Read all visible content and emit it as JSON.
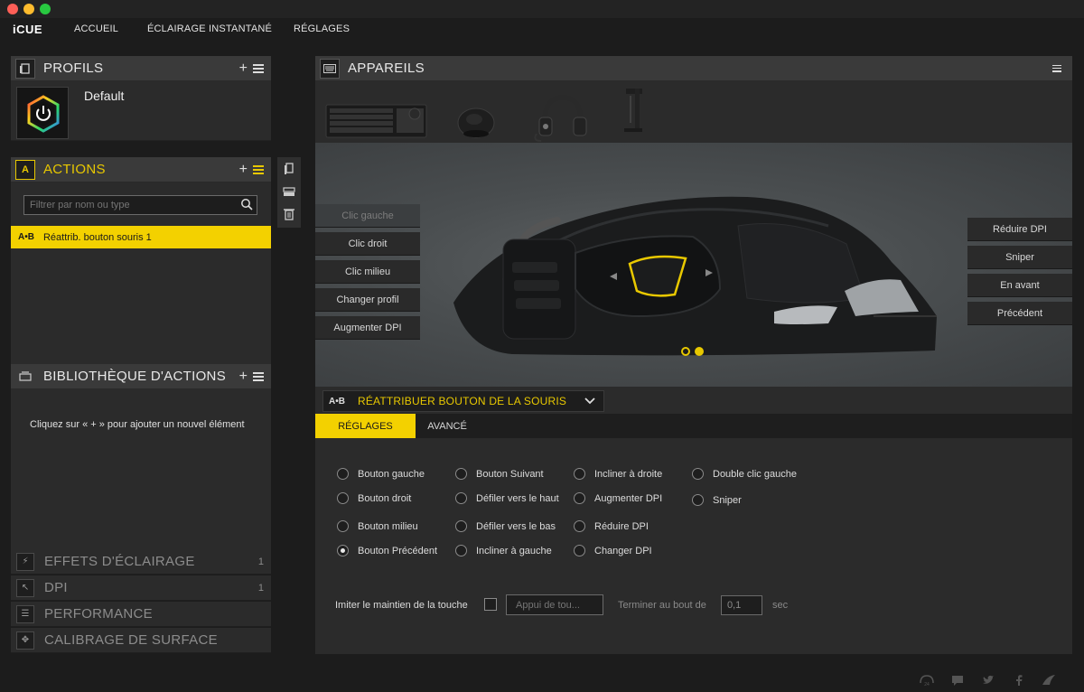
{
  "window": {
    "traffic_colors": [
      "#fe5f57",
      "#febc2e",
      "#28c840"
    ]
  },
  "nav": {
    "logo": "iCUE",
    "items": [
      "ACCUEIL",
      "ÉCLAIRAGE INSTANTANÉ",
      "RÉGLAGES"
    ]
  },
  "profiles": {
    "title": "PROFILS",
    "add_label": "+",
    "default_name": "Default"
  },
  "actions": {
    "title": "ACTIONS",
    "add_label": "+",
    "icon_label": "A",
    "filter_placeholder": "Filtrer par nom ou type",
    "items": [
      {
        "badge": "A•B",
        "label": "Réattrib. bouton souris 1"
      }
    ]
  },
  "library": {
    "title": "BIBLIOTHÈQUE D'ACTIONS",
    "add_label": "+",
    "hint": "Cliquez sur « + » pour ajouter un nouvel élément"
  },
  "sections": [
    {
      "title": "EFFETS D'ÉCLAIRAGE",
      "count": "1",
      "icon": "lightning-icon"
    },
    {
      "title": "DPI",
      "count": "1",
      "icon": "dpi-icon"
    },
    {
      "title": "PERFORMANCE",
      "count": "",
      "icon": "performance-icon"
    },
    {
      "title": "CALIBRAGE DE SURFACE",
      "count": "",
      "icon": "surface-icon"
    }
  ],
  "devices": {
    "title": "APPAREILS",
    "items": [
      "keyboard",
      "mouse",
      "headset",
      "headset-stand"
    ],
    "selected": "mouse"
  },
  "mouse_view": {
    "left_buttons": [
      {
        "label": "Clic gauche",
        "dim": true
      },
      {
        "label": "Clic droit",
        "dim": false
      },
      {
        "label": "Clic milieu",
        "dim": false
      },
      {
        "label": "Changer profil",
        "dim": false
      },
      {
        "label": "Augmenter DPI",
        "dim": false
      }
    ],
    "right_buttons": [
      "Réduire DPI",
      "Sniper",
      "En avant",
      "Précédent"
    ],
    "pages": 2,
    "current_page": 2
  },
  "editor": {
    "badge": "A•B",
    "action_type": "RÉATTRIBUER BOUTON DE LA SOURIS",
    "tabs": [
      "RÉGLAGES",
      "AVANCÉ"
    ],
    "options": [
      {
        "label": "Bouton gauche",
        "checked": false
      },
      {
        "label": "Bouton Suivant",
        "checked": false
      },
      {
        "label": "Incliner à droite",
        "checked": false
      },
      {
        "label": "Double clic gauche",
        "checked": false
      },
      {
        "label": "Bouton droit",
        "checked": false
      },
      {
        "label": "Défiler vers le haut",
        "checked": false
      },
      {
        "label": "Augmenter DPI",
        "checked": false
      },
      {
        "label": "Sniper",
        "checked": false
      },
      {
        "label": "Bouton milieu",
        "checked": false
      },
      {
        "label": "Défiler vers le bas",
        "checked": false
      },
      {
        "label": "Réduire DPI",
        "checked": false
      },
      {
        "label": "Bouton Précédent",
        "checked": true
      },
      {
        "label": "Incliner à gauche",
        "checked": false
      },
      {
        "label": "Changer DPI",
        "checked": false
      }
    ],
    "hold_label": "Imiter le maintien de la touche",
    "hold_placeholder": "Appui de tou...",
    "end_label": "Terminer au bout de",
    "end_value": "0,1",
    "sec_label": "sec"
  },
  "colors": {
    "accent": "#f3d100",
    "panel_header": "#3a3a3a",
    "panel_body": "#2b2b2b",
    "background": "#1c1c1c"
  }
}
